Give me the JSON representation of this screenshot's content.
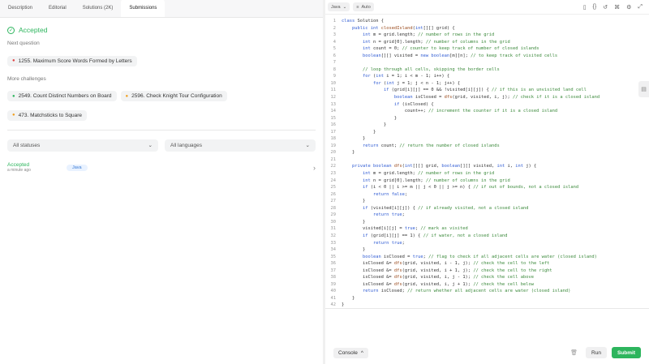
{
  "tabs": [
    "Description",
    "Editorial",
    "Solutions (2K)",
    "Submissions"
  ],
  "status": "Accepted",
  "next_question_label": "Next question",
  "next_question": "1255. Maximum Score Words Formed by Letters",
  "more_challenges_label": "More challenges",
  "challenges": [
    "2549. Count Distinct Numbers on Board",
    "2596. Check Knight Tour Configuration",
    "473. Matchsticks to Square"
  ],
  "filters": {
    "status": "All statuses",
    "language": "All languages"
  },
  "submission": {
    "status": "Accepted",
    "time": "a minute ago",
    "lang": "Java"
  },
  "editor": {
    "language": "Java",
    "mode": "Auto"
  },
  "code": [
    "class Solution {",
    "    public int closedIsland(int[][] grid) {",
    "        int m = grid.length; // number of rows in the grid",
    "        int n = grid[0].length; // number of columns in the grid",
    "        int count = 0; // counter to keep track of number of closed islands",
    "        boolean[][] visited = new boolean[m][n]; // to keep track of visited cells",
    "",
    "        // loop through all cells, skipping the border cells",
    "        for (int i = 1; i < m - 1; i++) {",
    "            for (int j = 1; j < n - 1; j++) {",
    "                if (grid[i][j] == 0 && !visited[i][j]) { // if this is an unvisited land cell",
    "                    boolean isClosed = dfs(grid, visited, i, j); // check if it is a closed island",
    "                    if (isClosed) {",
    "                        count++; // increment the counter if it is a closed island",
    "                    }",
    "                }",
    "            }",
    "        }",
    "        return count; // return the number of closed islands",
    "    }",
    "",
    "    private boolean dfs(int[][] grid, boolean[][] visited, int i, int j) {",
    "        int m = grid.length; // number of rows in the grid",
    "        int n = grid[0].length; // number of columns in the grid",
    "        if (i < 0 || i >= m || j < 0 || j >= n) { // if out of bounds, not a closed island",
    "            return false;",
    "        }",
    "        if (visited[i][j]) { // if already visited, not a closed island",
    "            return true;",
    "        }",
    "        visited[i][j] = true; // mark as visited",
    "        if (grid[i][j] == 1) { // if water, not a closed island",
    "            return true;",
    "        }",
    "        boolean isClosed = true; // flag to check if all adjacent cells are water (closed island)",
    "        isClosed &= dfs(grid, visited, i - 1, j); // check the cell to the left",
    "        isClosed &= dfs(grid, visited, i + 1, j); // check the cell to the right",
    "        isClosed &= dfs(grid, visited, i, j - 1); // check the cell above",
    "        isClosed &= dfs(grid, visited, i, j + 1); // check the cell below",
    "        return isClosed; // return whether all adjacent cells are water (closed island)",
    "    }",
    "}"
  ],
  "buttons": {
    "console": "Console",
    "run": "Run",
    "submit": "Submit"
  },
  "colors": {
    "accent_green": "#2db55d",
    "link_blue": "#3a7bd5"
  }
}
